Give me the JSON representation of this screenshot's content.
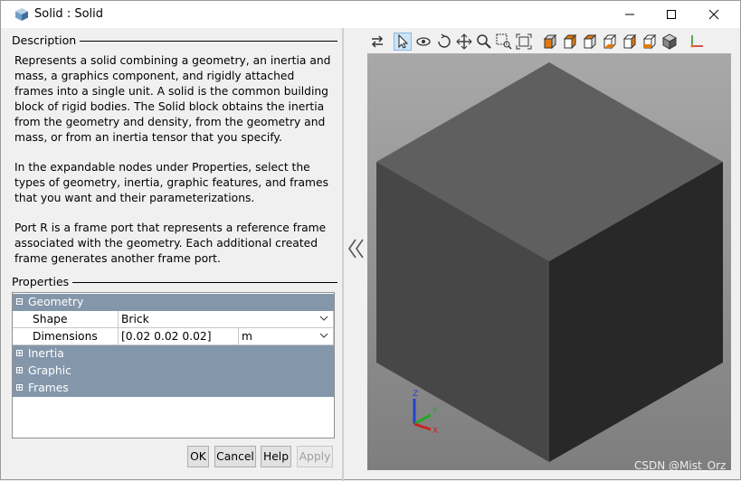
{
  "window": {
    "title": "Solid : Solid",
    "controls": {
      "minimize": "minimize",
      "maximize": "maximize",
      "close": "close"
    }
  },
  "description": {
    "label": "Description",
    "paragraphs": [
      "Represents a solid combining a geometry, an inertia and mass, a graphics component, and rigidly attached frames into a single unit. A solid is the common building block of rigid bodies. The Solid block obtains the inertia from the geometry and density, from the geometry and mass, or from an inertia tensor that you specify.",
      "In the expandable nodes under Properties, select the types of geometry, inertia, graphic features, and frames that you want and their parameterizations.",
      "Port R is a frame port that represents a reference frame associated with the geometry. Each additional created frame generates another frame port."
    ]
  },
  "properties": {
    "label": "Properties",
    "geometry": {
      "label": "Geometry",
      "shape_label": "Shape",
      "shape_value": "Brick",
      "dimensions_label": "Dimensions",
      "dimensions_value": "[0.02 0.02 0.02]",
      "dimensions_unit": "m"
    },
    "nodes": [
      "Inertia",
      "Graphic",
      "Frames"
    ]
  },
  "buttons": {
    "ok": "OK",
    "cancel": "Cancel",
    "help": "Help",
    "apply": "Apply"
  },
  "toolbar_icons": [
    "swap-icon",
    "select-pointer-icon",
    "rotate-view-icon",
    "orbit-icon",
    "pan-icon",
    "zoom-icon",
    "zoom-box-icon",
    "fit-view-icon",
    "front-view-icon",
    "back-view-icon",
    "left-view-icon",
    "right-view-icon",
    "top-view-icon",
    "bottom-view-icon",
    "isometric-view-icon",
    "axes-triad-icon"
  ],
  "triad": {
    "x": "X",
    "y": "Y",
    "z": "Z"
  },
  "watermark": "CSDN @Mist_Orz",
  "colors": {
    "header_row": "#8496aa",
    "cube_top": "#5f5f5f",
    "cube_left": "#474747",
    "cube_right": "#282828"
  }
}
